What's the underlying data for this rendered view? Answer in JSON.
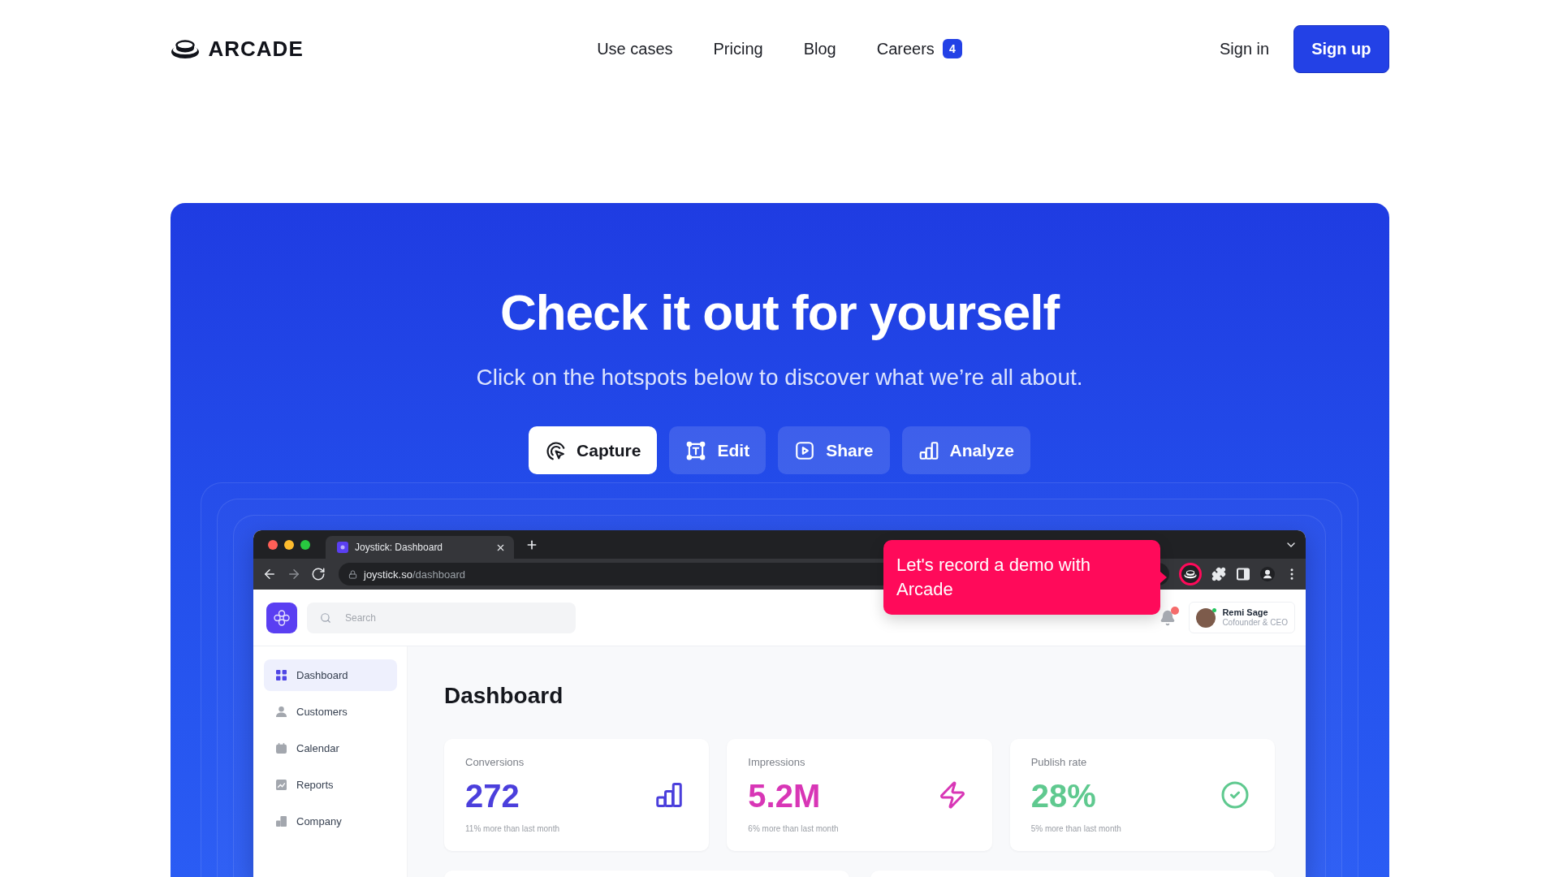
{
  "header": {
    "logo": "ARCADE",
    "nav": [
      {
        "label": "Use cases"
      },
      {
        "label": "Pricing"
      },
      {
        "label": "Blog"
      },
      {
        "label": "Careers",
        "badge": "4"
      }
    ],
    "sign_in": "Sign in",
    "sign_up": "Sign up"
  },
  "hero": {
    "title": "Check it out for yourself",
    "subtitle": "Click on the hotspots below to discover what we’re all about.",
    "tabs": [
      {
        "label": "Capture",
        "selected": true
      },
      {
        "label": "Edit",
        "selected": false
      },
      {
        "label": "Share",
        "selected": false
      },
      {
        "label": "Analyze",
        "selected": false
      }
    ]
  },
  "browser": {
    "tab_title": "Joystick: Dashboard",
    "url_host": "joystick.so",
    "url_path": "/dashboard",
    "extension_highlighted": true
  },
  "tooltip": {
    "text": "Let's record a demo with Arcade"
  },
  "app": {
    "search": {
      "placeholder": "Search"
    },
    "notifications_unread": true,
    "user": {
      "name": "Remi Sage",
      "role": "Cofounder & CEO",
      "online": true
    },
    "sidebar": [
      {
        "label": "Dashboard",
        "selected": true
      },
      {
        "label": "Customers",
        "selected": false
      },
      {
        "label": "Calendar",
        "selected": false
      },
      {
        "label": "Reports",
        "selected": false
      },
      {
        "label": "Company",
        "selected": false
      }
    ],
    "heading": "Dashboard",
    "stats": [
      {
        "label": "Conversions",
        "value": "272",
        "note": "11% more than last month",
        "color": "#4b3fdc"
      },
      {
        "label": "Impressions",
        "value": "5.2M",
        "note": "6% more than last month",
        "color": "#d836b6"
      },
      {
        "label": "Publish rate",
        "value": "28%",
        "note": "5% more than last month",
        "color": "#5fc98f"
      }
    ]
  }
}
